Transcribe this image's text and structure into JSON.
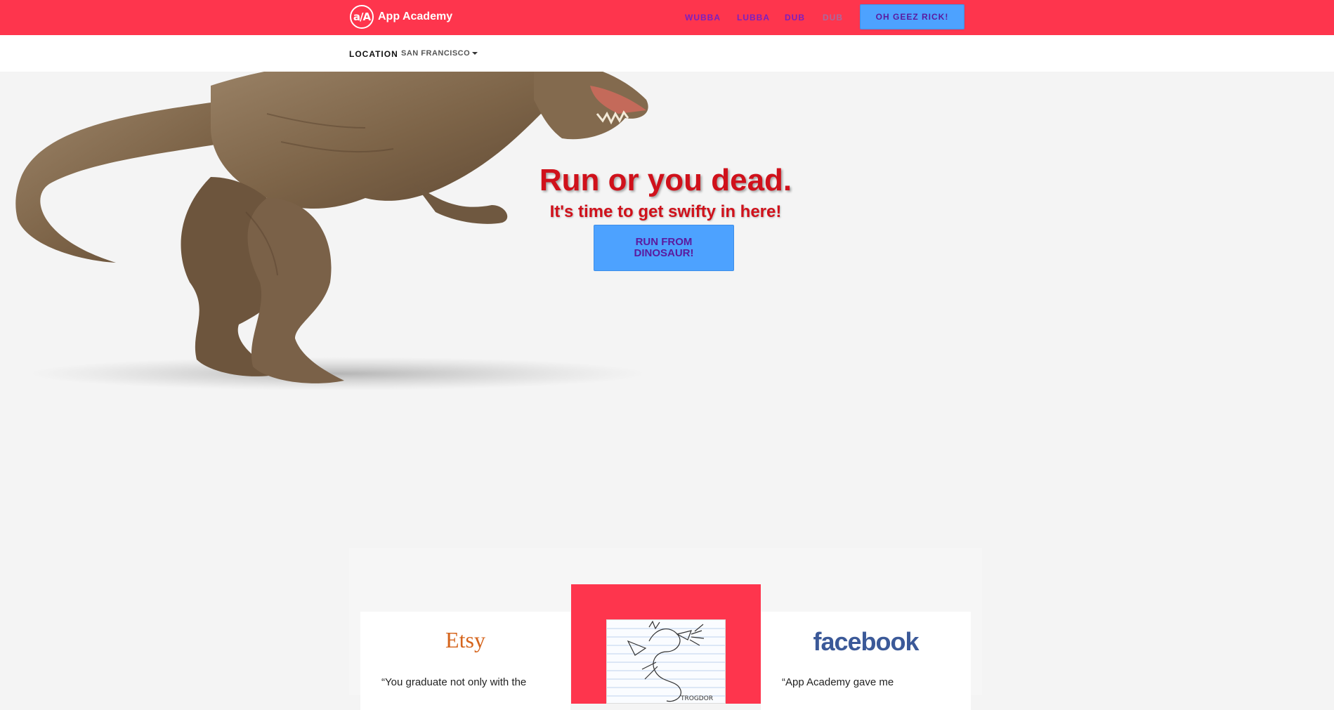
{
  "brand": {
    "logo_text": "a/A",
    "name": "App Academy"
  },
  "nav": {
    "items": [
      {
        "label": "WUBBA"
      },
      {
        "label": "LUBBA"
      },
      {
        "label": "DUB"
      },
      {
        "label": "DUB"
      }
    ],
    "cta_label": "OH GEEZ RICK!"
  },
  "location": {
    "label": "LOCATION",
    "value": "SAN FRANCISCO"
  },
  "hero": {
    "title": "Run or you dead.",
    "subtitle": "It's time to get swifty in here!",
    "button_label": "RUN FROM DINOSAUR!"
  },
  "testimonials": {
    "left": {
      "company": "Etsy",
      "quote": "“You graduate not only with the"
    },
    "center": {
      "sketch_caption": "TROGDOR"
    },
    "right": {
      "company": "facebook",
      "quote": "“App Academy gave me"
    }
  },
  "colors": {
    "primary_red": "#fe354d",
    "button_blue": "#4da2ff",
    "nav_purple": "#7a1fc2",
    "hero_red": "#d0111b",
    "etsy_orange": "#d5641c",
    "facebook_blue": "#3b5998"
  }
}
